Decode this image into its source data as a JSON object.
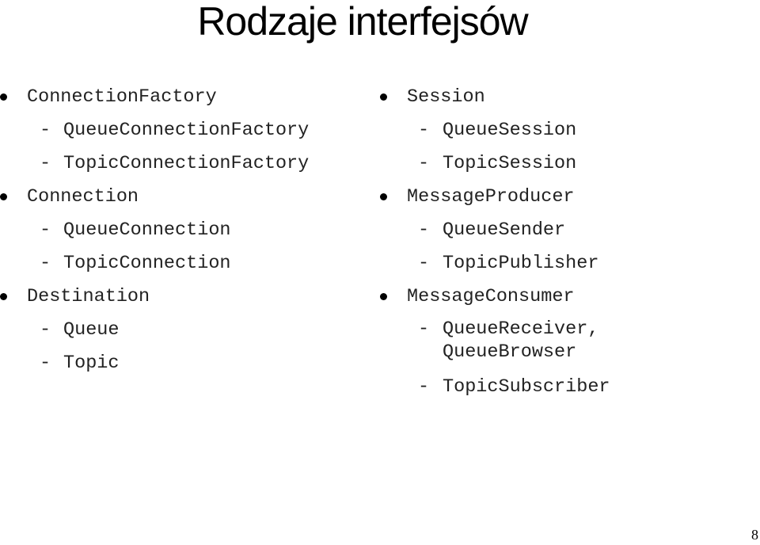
{
  "slide": {
    "title": "Rodzaje interfejsów",
    "page_number": "8",
    "bullet_icon": "bullet-dot",
    "dash_symbol": "-"
  },
  "left_column": [
    {
      "label": "ConnectionFactory",
      "children": [
        "QueueConnectionFactory",
        "TopicConnectionFactory"
      ]
    },
    {
      "label": "Connection",
      "children": [
        "QueueConnection",
        "TopicConnection"
      ]
    },
    {
      "label": "Destination",
      "children": [
        "Queue",
        "Topic"
      ]
    }
  ],
  "right_column": [
    {
      "label": "Session",
      "children": [
        "QueueSession",
        "TopicSession"
      ]
    },
    {
      "label": "MessageProducer",
      "children": [
        "QueueSender",
        "TopicPublisher"
      ]
    },
    {
      "label": "MessageConsumer",
      "children": [
        "QueueReceiver,\nQueueBrowser",
        "TopicSubscriber"
      ]
    }
  ]
}
